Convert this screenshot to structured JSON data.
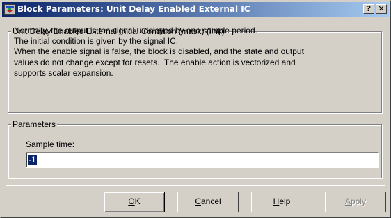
{
  "window": {
    "title": "Block Parameters: Unit Delay Enabled External IC",
    "help_button": "?",
    "close_button": "✕"
  },
  "description_group": {
    "legend": "Unit Delay Enabled External Initial Condition (mask) (link)",
    "lines": [
      "Normally, the output is the signal u delayed by one sample period.",
      "The initial condition is given by the signal IC.",
      "When the enable signal is false, the block is disabled, and the state and output",
      "values do not change except for resets.  The enable action is vectorized and",
      "supports scalar expansion."
    ]
  },
  "parameters_group": {
    "legend": "Parameters",
    "sample_time_label": "Sample time:",
    "sample_time_value": "-1"
  },
  "buttons": {
    "ok": {
      "mnemonic": "O",
      "rest": "K"
    },
    "cancel": {
      "mnemonic": "C",
      "rest": "ancel"
    },
    "help": {
      "mnemonic": "H",
      "rest": "elp"
    },
    "apply": {
      "mnemonic": "A",
      "rest": "pply"
    }
  }
}
